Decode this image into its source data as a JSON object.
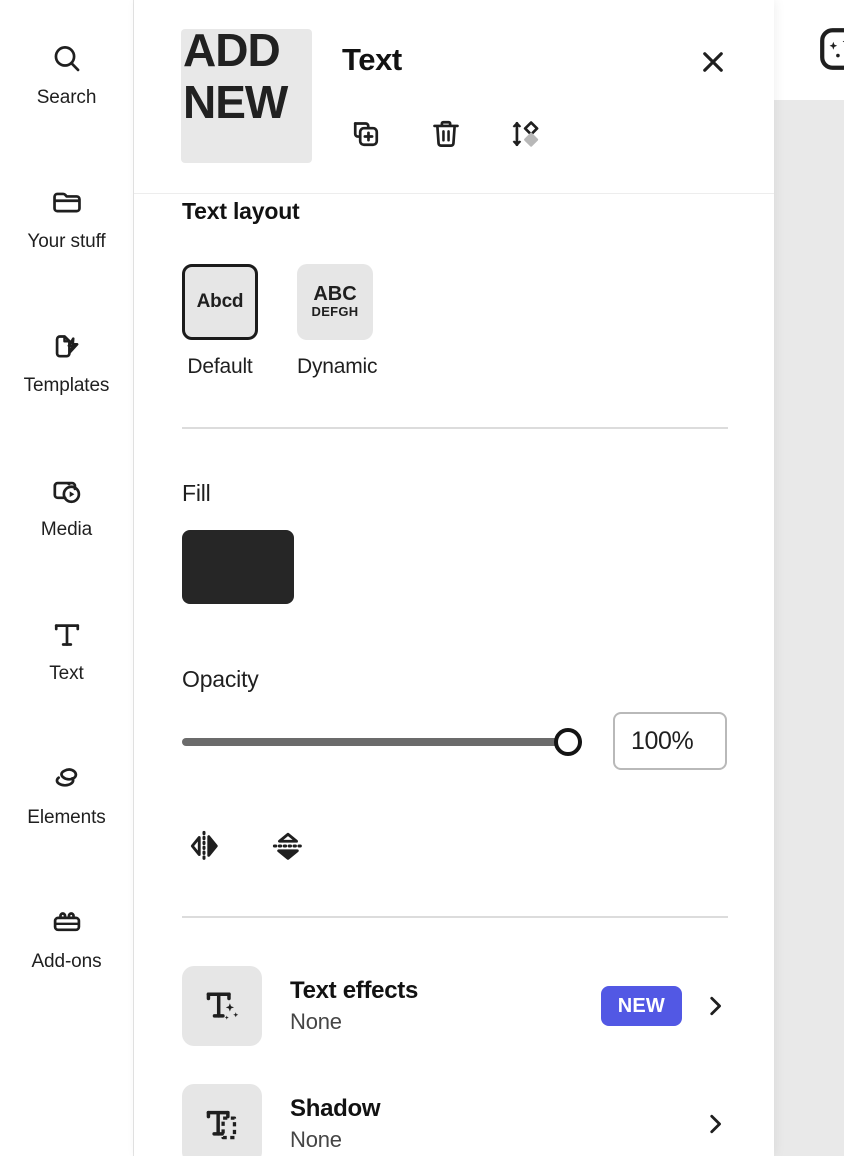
{
  "colors": {
    "accent_badge": "#5258e4",
    "fill_swatch": "#262626",
    "panel_bg": "#ffffff",
    "canvas_bg": "#e9e9e9",
    "slider_track": "#6b6b6b",
    "selected_border": "#1b1b1b"
  },
  "rail": {
    "items": [
      {
        "label": "Search",
        "icon": "search-icon"
      },
      {
        "label": "Your stuff",
        "icon": "folder-icon"
      },
      {
        "label": "Templates",
        "icon": "templates-icon"
      },
      {
        "label": "Media",
        "icon": "media-icon"
      },
      {
        "label": "Text",
        "icon": "text-icon"
      },
      {
        "label": "Elements",
        "icon": "elements-icon"
      },
      {
        "label": "Add-ons",
        "icon": "addons-icon"
      }
    ]
  },
  "header": {
    "thumbnail_text": "ADD\nNEW",
    "title": "Text",
    "close_icon": "close-icon",
    "actions": [
      {
        "name": "duplicate",
        "icon": "duplicate-icon"
      },
      {
        "name": "delete",
        "icon": "trash-icon"
      },
      {
        "name": "arrange",
        "icon": "arrange-layers-icon"
      }
    ]
  },
  "canvas": {
    "floating_icon": "generative-ai-icon"
  },
  "text_layout": {
    "title": "Text layout",
    "options": [
      {
        "label": "Default",
        "preview_line1": "Abcd",
        "preview_line2": "",
        "selected": true
      },
      {
        "label": "Dynamic",
        "preview_line1": "ABC",
        "preview_line2": "DEFGH",
        "selected": false
      }
    ]
  },
  "fill": {
    "title": "Fill",
    "color": "#262626"
  },
  "opacity": {
    "title": "Opacity",
    "value": "100%",
    "percent": 100,
    "min": 0,
    "max": 100
  },
  "transform": {
    "buttons": [
      {
        "name": "flip-horizontal",
        "icon": "flip-horizontal-icon"
      },
      {
        "name": "flip-vertical",
        "icon": "flip-vertical-icon"
      }
    ]
  },
  "effects": [
    {
      "name": "Text effects",
      "value": "None",
      "icon": "text-effects-icon",
      "badge": "NEW",
      "has_badge": true,
      "chevron": "chevron-right-icon"
    },
    {
      "name": "Shadow",
      "value": "None",
      "icon": "text-shadow-icon",
      "badge": "",
      "has_badge": false,
      "chevron": "chevron-right-icon"
    }
  ]
}
